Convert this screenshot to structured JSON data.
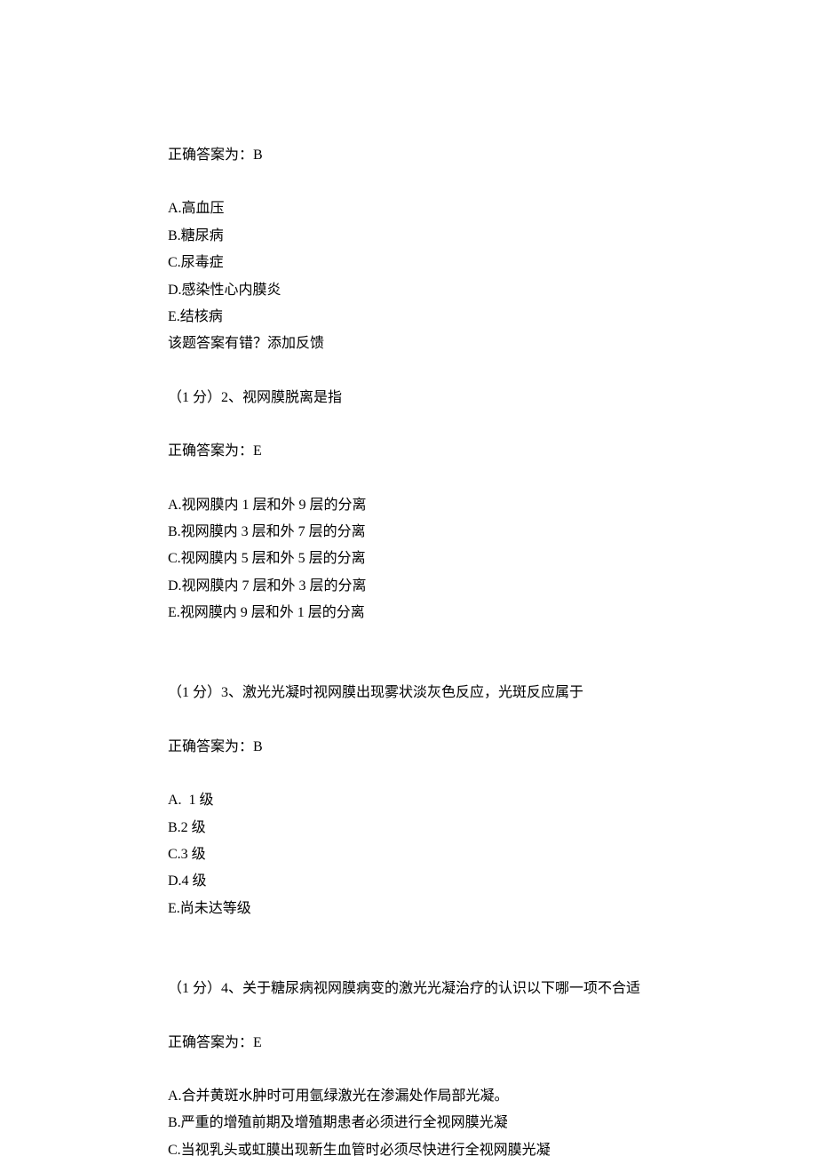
{
  "q1": {
    "answer_line": "正确答案为：B",
    "options": {
      "A": "A.高血压",
      "B": "B.糖尿病",
      "C": "C.尿毒症",
      "D": "D.感染性心内膜炎",
      "E": "E.结核病"
    },
    "feedback_line": "该题答案有错？添加反馈"
  },
  "q2": {
    "prompt": "（1 分）2、视网膜脱离是指",
    "answer_line": "正确答案为：E",
    "options": {
      "A": "A.视网膜内 1 层和外 9 层的分离",
      "B": "B.视网膜内 3 层和外 7 层的分离",
      "C": "C.视网膜内 5 层和外 5 层的分离",
      "D": "D.视网膜内 7 层和外 3 层的分离",
      "E": "E.视网膜内 9 层和外 1 层的分离"
    }
  },
  "q3": {
    "prompt": "（1 分）3、激光光凝时视网膜出现雾状淡灰色反应，光斑反应属于",
    "answer_line": "正确答案为：B",
    "options": {
      "A": "A.  1 级",
      "B": "B.2 级",
      "C": "C.3 级",
      "D": "D.4 级",
      "E": "E.尚未达等级"
    }
  },
  "q4": {
    "prompt": "（1 分）4、关于糖尿病视网膜病变的激光光凝治疗的认识以下哪一项不合适",
    "answer_line": "正确答案为：E",
    "options": {
      "A": "A.合并黄斑水肿时可用氩绿激光在渗漏处作局部光凝。",
      "B": "B.严重的增殖前期及增殖期患者必须进行全视网膜光凝",
      "C": "C.当视乳头或虹膜出现新生血管时必须尽快进行全视网膜光凝"
    }
  }
}
